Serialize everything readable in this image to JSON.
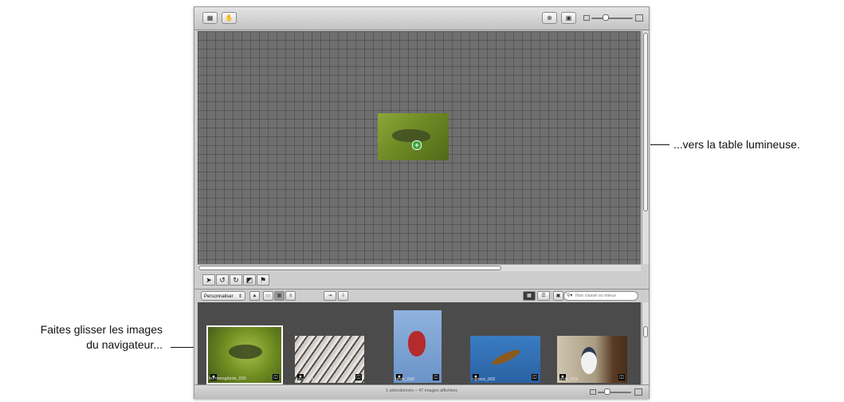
{
  "toolbar": {
    "left_icons": [
      "view-mode-icon",
      "hand-icon"
    ],
    "right_icons": [
      "zoom-to-fit-icon",
      "image-icon"
    ]
  },
  "light_table": {
    "dragged_image": "hummingbirds_030",
    "drop_indicator": "+"
  },
  "tools": [
    "arrow-tool-icon",
    "rotate-left-icon",
    "rotate-right-icon",
    "crop-icon",
    "flag-icon"
  ],
  "browser": {
    "popup_label": "Personnaliser",
    "search_placeholder": "Non classé ou mieux",
    "images": [
      {
        "name": "hummingbirds_030",
        "selected": true,
        "colors": [
          "#7f9a2a",
          "#4a6419"
        ]
      },
      {
        "name": "jays_001",
        "selected": false,
        "colors": [
          "#d8d8d8",
          "#5c4a3e"
        ]
      },
      {
        "name": "birds_030",
        "selected": false,
        "colors": [
          "#7fa8d8",
          "#b42a2a"
        ]
      },
      {
        "name": "raptors_002",
        "selected": false,
        "colors": [
          "#2e6fb5",
          "#8a5a1e"
        ]
      },
      {
        "name": "birds_015",
        "selected": false,
        "colors": [
          "#b8b29e",
          "#5a3a22"
        ]
      }
    ],
    "status": "1 sélectionnés – 47 images affichées"
  },
  "callouts": {
    "right": "...vers la table lumineuse.",
    "left_line1": "Faites glisser les images",
    "left_line2": "du navigateur..."
  }
}
